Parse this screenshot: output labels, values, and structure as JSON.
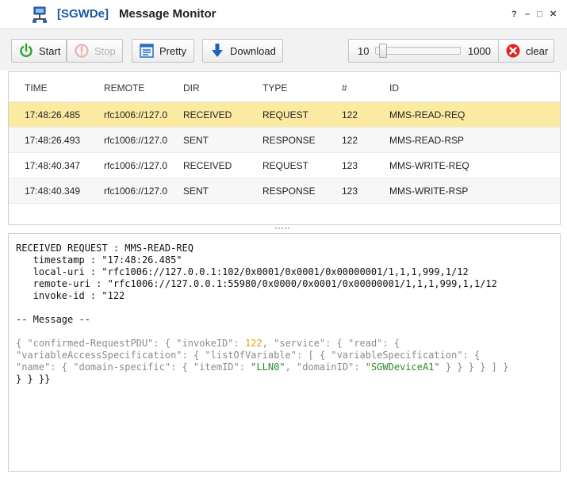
{
  "window": {
    "brand": "[SGWDe]",
    "title": "Message Monitor",
    "controls": [
      "?",
      "–",
      "□",
      "✕"
    ]
  },
  "toolbar": {
    "start_label": "Start",
    "stop_label": "Stop",
    "pretty_label": "Pretty",
    "download_label": "Download",
    "slider_min": "10",
    "slider_max": "1000",
    "slider_level_fraction": 0.05,
    "clear_label": "clear"
  },
  "grid": {
    "columns": [
      "TIME",
      "REMOTE",
      "DIR",
      "TYPE",
      "#",
      "ID"
    ],
    "rows": [
      {
        "time": "17:48:26.485",
        "remote": "rfc1006://127.0",
        "dir": "RECEIVED",
        "type": "REQUEST",
        "num": "122",
        "id": "MMS-READ-REQ"
      },
      {
        "time": "17:48:26.493",
        "remote": "rfc1006://127.0",
        "dir": "SENT",
        "type": "RESPONSE",
        "num": "122",
        "id": "MMS-READ-RSP"
      },
      {
        "time": "17:48:40.347",
        "remote": "rfc1006://127.0",
        "dir": "RECEIVED",
        "type": "REQUEST",
        "num": "123",
        "id": "MMS-WRITE-REQ"
      },
      {
        "time": "17:48:40.349",
        "remote": "rfc1006://127.0",
        "dir": "SENT",
        "type": "RESPONSE",
        "num": "123",
        "id": "MMS-WRITE-RSP"
      }
    ],
    "selected_row": 0
  },
  "detail": {
    "header": "RECEIVED REQUEST : MMS-READ-REQ",
    "timestamp": "   timestamp : \"17:48:26.485\"",
    "local_uri": "   local-uri : \"rfc1006://127.0.0.1:102/0x0001/0x0001/0x00000001/1,1,1,999,1/12",
    "remote_uri": "   remote-uri : \"rfc1006://127.0.0.1:55980/0x0000/0x0001/0x00000001/1,1,1,999,1,1/12",
    "invoke_id": "   invoke-id : \"122",
    "message_label": "-- Message --",
    "json_l1_a": "{ \"confirmed-RequestPDU\": { \"invokeID\": ",
    "json_l1_num": "122",
    "json_l1_b": ", \"service\": { \"read\": {",
    "json_l2": "\"variableAccessSpecification\": { \"listOfVariable\": [ { \"variableSpecification\": {",
    "json_l3_a": "\"name\": { \"domain-specific\": { \"itemID\": ",
    "json_l3_item": "\"LLN0\"",
    "json_l3_b": ", \"domainID\": ",
    "json_l3_domain": "\"SGWDeviceA1\"",
    "json_l3_c": " } } } } ] }",
    "json_l4": "} } }}"
  }
}
